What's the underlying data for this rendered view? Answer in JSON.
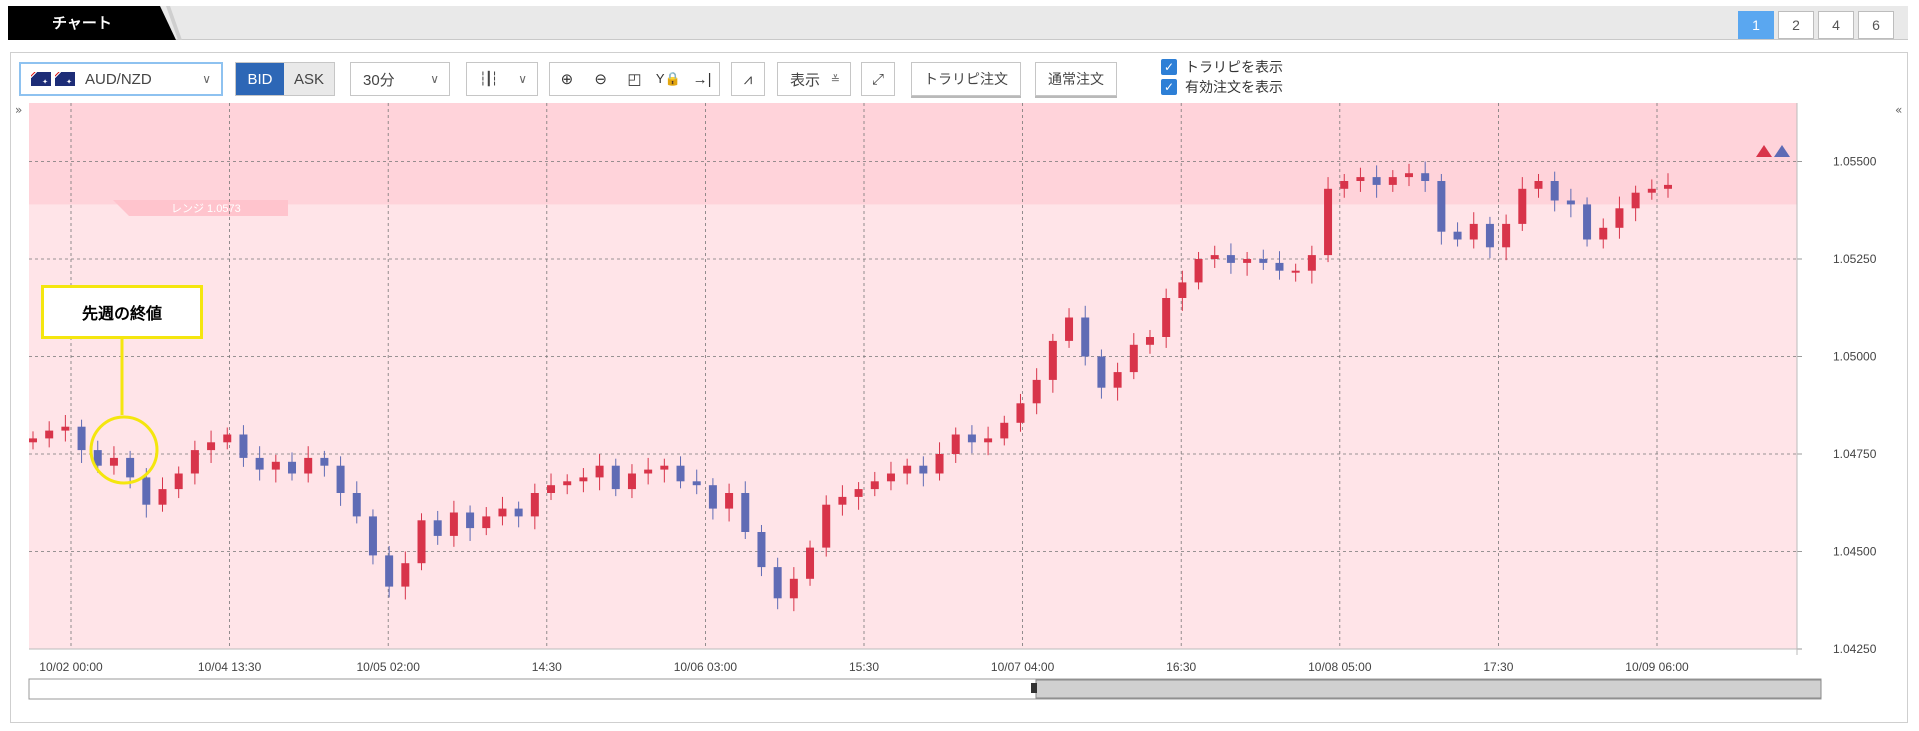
{
  "tab": {
    "label": "チャート"
  },
  "pages": [
    "1",
    "2",
    "4",
    "6"
  ],
  "active_page": "1",
  "toolbar": {
    "symbol": "AUD/NZD",
    "bid_label": "BID",
    "ask_label": "ASK",
    "interval": "30分",
    "display_label": "表示",
    "trap_order_label": "トラリピ注文",
    "normal_order_label": "通常注文",
    "check_trap": "トラリピを表示",
    "check_active": "有効注文を表示"
  },
  "annotation": {
    "label": "先週の終値"
  },
  "range_label": "レンジ 1.0573",
  "colors": {
    "up": "#d8344a",
    "down": "#5f6bb5",
    "background": "#ffe4e8",
    "highlight": "#ffd3da",
    "callout": "#f4e60e",
    "accent": "#2d67b6"
  },
  "chart_data": {
    "type": "candlestick",
    "x_ticks": [
      "10/02 00:00",
      "10/04 13:30",
      "10/05 02:00",
      "14:30",
      "10/06 03:00",
      "15:30",
      "10/07 04:00",
      "16:30",
      "10/08 05:00",
      "17:30",
      "10/09 06:00"
    ],
    "y_ticks": [
      "1.05500",
      "1.05250",
      "1.05000",
      "1.04750",
      "1.04500",
      "1.04250"
    ],
    "ylim": [
      1.0425,
      1.0565
    ],
    "series": [
      {
        "values": [
          1.0479,
          1.0481,
          1.0482,
          1.0476,
          1.0472,
          1.0474,
          1.0469,
          1.0462,
          1.0466,
          1.047,
          1.0476,
          1.0478,
          1.048,
          1.0474,
          1.0471,
          1.0473,
          1.047,
          1.0474,
          1.0472,
          1.0465,
          1.0459,
          1.0449,
          1.0441,
          1.0447,
          1.0458,
          1.0454,
          1.046,
          1.0456,
          1.0459,
          1.0461,
          1.0459,
          1.0465,
          1.0467,
          1.0468,
          1.0469,
          1.0472,
          1.0466,
          1.047,
          1.0471,
          1.0472,
          1.0468,
          1.0467,
          1.0461,
          1.0465,
          1.0455,
          1.0446,
          1.0438,
          1.0443,
          1.0451,
          1.0462,
          1.0464,
          1.0466,
          1.0468,
          1.047,
          1.0472,
          1.047,
          1.0475,
          1.048,
          1.0478,
          1.0479,
          1.0483,
          1.0488,
          1.0494,
          1.0504,
          1.051,
          1.05,
          1.0492,
          1.0496,
          1.0503,
          1.0505,
          1.0515,
          1.0519,
          1.0525,
          1.0526,
          1.0524,
          1.0525,
          1.0524,
          1.0522,
          1.0522,
          1.0526,
          1.0543,
          1.0545,
          1.0546,
          1.0544,
          1.0546,
          1.0547,
          1.0545,
          1.0532,
          1.053,
          1.0534,
          1.0528,
          1.0534,
          1.0543,
          1.0545,
          1.054,
          1.0539,
          1.053,
          1.0533,
          1.0538,
          1.0542,
          1.0543,
          1.0544
        ]
      }
    ]
  }
}
